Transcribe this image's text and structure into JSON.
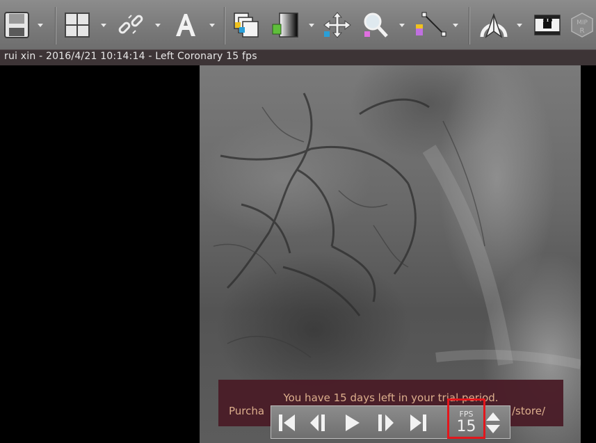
{
  "toolbar": {
    "tools": [
      {
        "icon": "save-icon"
      },
      {
        "icon": "layout-grid-icon"
      },
      {
        "icon": "sync-link-icon"
      },
      {
        "icon": "annotation-text-icon",
        "glyph": "A"
      },
      {
        "icon": "series-stack-icon"
      },
      {
        "icon": "window-level-icon"
      },
      {
        "icon": "pan-icon"
      },
      {
        "icon": "zoom-icon"
      },
      {
        "icon": "measure-icon"
      },
      {
        "icon": "reference-lines-icon"
      },
      {
        "icon": "movie-export-icon"
      },
      {
        "icon": "mip-render-icon",
        "glyph": "MIP R"
      }
    ]
  },
  "viewer": {
    "title": "rui xin - 2016/4/21 10:14:14 - Left Coronary 15 fps"
  },
  "trial": {
    "line1": "You have 15 days left in your trial period.",
    "line2_start": "Purcha",
    "line2_end": "/store/"
  },
  "player": {
    "fps_label": "FPS",
    "fps_value": "15",
    "controls": [
      "first-frame-icon",
      "previous-frame-icon",
      "play-icon",
      "next-frame-icon",
      "last-frame-icon"
    ]
  },
  "colors": {
    "toolbar": "#7a7a7a",
    "titlebar": "#3d3436",
    "trial_banner": "#4a1d28",
    "trial_text": "#e2b28f",
    "highlight": "#e3161c"
  }
}
